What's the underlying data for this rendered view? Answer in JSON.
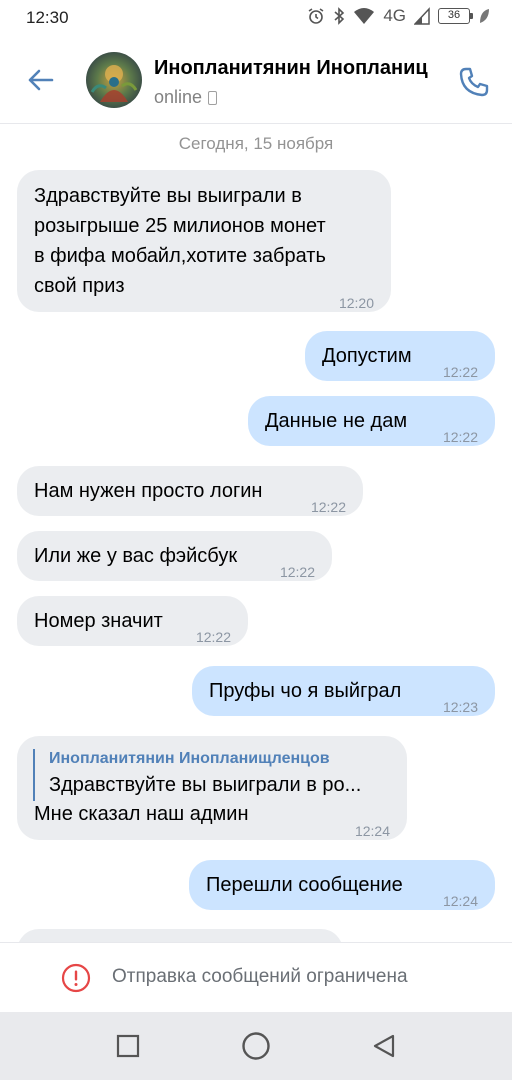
{
  "status_bar": {
    "time": "12:30",
    "network": "4G",
    "battery": "36"
  },
  "header": {
    "back_icon": "arrow-left-icon",
    "title": "Инопланитянин Инопланиц",
    "status": "online",
    "call_icon": "phone-icon",
    "accent_color": "#5181b8"
  },
  "chat": {
    "date": "Сегодня, 15 ноября",
    "messages": [
      {
        "dir": "in",
        "lines": [
          "Здравствуйте вы выиграли в",
          "розыгрыше 25 милионов монет",
          "в фифа мобайл,хотите забрать",
          "свой приз"
        ],
        "time": "12:20"
      },
      {
        "dir": "out",
        "text": "Допустим",
        "time": "12:22"
      },
      {
        "dir": "out",
        "text": "Данные не дам",
        "time": "12:22"
      },
      {
        "dir": "in",
        "text": "Нам нужен просто логин",
        "time": "12:22"
      },
      {
        "dir": "in",
        "text": "Или же у вас фэйсбук",
        "time": "12:22"
      },
      {
        "dir": "in",
        "text": "Номер значит",
        "time": "12:22"
      },
      {
        "dir": "out",
        "text": "Пруфы чо я выйграл",
        "time": "12:23"
      },
      {
        "dir": "in",
        "reply_author": "Инопланитянин Инопланищленцов",
        "reply_text": "Здравствуйте вы выиграли в ро...",
        "text": "Мне сказал наш админ",
        "time": "12:24"
      },
      {
        "dir": "out",
        "text": "Перешли сообщение",
        "time": "12:24"
      }
    ]
  },
  "restriction": {
    "icon": "warning-circle-icon",
    "text": "Отправка сообщений ограничена",
    "icon_color": "#e64646"
  },
  "navbar": {
    "recent_icon": "square-icon",
    "home_icon": "circle-icon",
    "back_icon": "triangle-back-icon"
  }
}
